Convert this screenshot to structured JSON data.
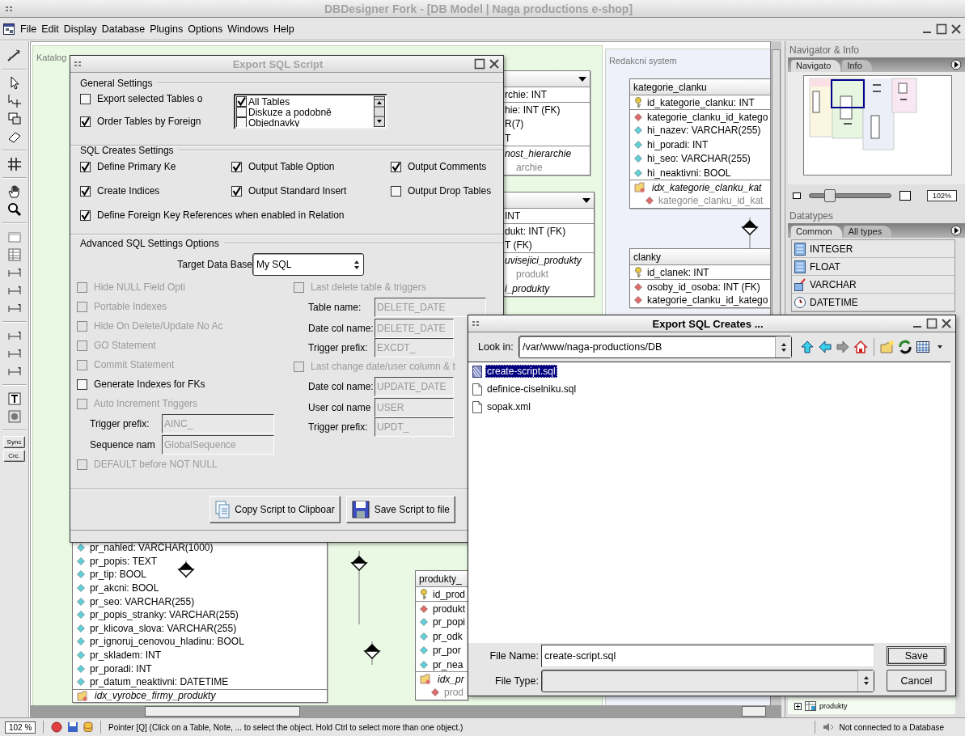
{
  "window": {
    "title": "DBDesigner Fork - [DB Model | Naga productions e-shop]"
  },
  "menu": [
    "File",
    "Edit",
    "Display",
    "Database",
    "Plugins",
    "Options",
    "Windows",
    "Help"
  ],
  "toolbox": {
    "buttons": [
      "Sync",
      "Crc."
    ]
  },
  "canvas": {
    "regions": [
      {
        "title": "Katalog",
        "color": "#eaf9e4"
      },
      {
        "title": "Redakcni system",
        "color": "#eef0fa"
      }
    ],
    "tables": [
      {
        "header": true,
        "columns": [
          {
            "kind": "plain_pk",
            "text": "rchie: INT"
          },
          {
            "kind": "plain",
            "text": "hie: INT (FK)"
          },
          {
            "kind": "plain",
            "text": "R(7)"
          },
          {
            "kind": "plain",
            "text": "T"
          },
          {
            "kind": "plain_idx",
            "text": "nost_hierarchie"
          },
          {
            "kind": "plain_idxcol",
            "text": "archie"
          }
        ]
      },
      {
        "header": true,
        "columns": [
          {
            "kind": "plain_pk",
            "text": "INT"
          },
          {
            "kind": "plain",
            "text": "dukt: INT (FK)"
          },
          {
            "kind": "plain",
            "text": "T (FK)"
          },
          {
            "kind": "plain_idx",
            "text": "uvisejici_produkty"
          },
          {
            "kind": "plain_idxcol",
            "text": "produkt"
          },
          {
            "kind": "plain_idx",
            "text": "i_produkty"
          }
        ]
      },
      {
        "header": true,
        "name": "kategorie_clanku",
        "columns": [
          {
            "kind": "pk",
            "text": "id_kategorie_clanku: INT"
          },
          {
            "kind": "fk",
            "text": "kategorie_clanku_id_katego"
          },
          {
            "kind": "col",
            "text": "hi_nazev: VARCHAR(255)"
          },
          {
            "kind": "col",
            "text": "hi_poradi: INT"
          },
          {
            "kind": "col",
            "text": "hi_seo: VARCHAR(255)"
          },
          {
            "kind": "col",
            "text": "hi_neaktivni: BOOL"
          },
          {
            "kind": "idx",
            "text": "idx_kategorie_clanku_kat"
          },
          {
            "kind": "idxcol",
            "text": "kategorie_clanku_id_kat"
          }
        ]
      },
      {
        "header": true,
        "name": "clanky",
        "columns": [
          {
            "kind": "pk",
            "text": "id_clanek: INT"
          },
          {
            "kind": "fk",
            "text": "osoby_id_osoba: INT (FK)"
          },
          {
            "kind": "fk",
            "text": "kategorie_clanku_id_katego"
          }
        ]
      },
      {
        "header": false,
        "columns": [
          {
            "kind": "col",
            "text": "pr_nahled: VARCHAR(1000)"
          },
          {
            "kind": "col",
            "text": "pr_popis: TEXT"
          },
          {
            "kind": "col",
            "text": "pr_tip: BOOL"
          },
          {
            "kind": "col",
            "text": "pr_akcni: BOOL"
          },
          {
            "kind": "col",
            "text": "pr_seo: VARCHAR(255)"
          },
          {
            "kind": "col",
            "text": "pr_popis_stranky: VARCHAR(255)"
          },
          {
            "kind": "col",
            "text": "pr_klicova_slova: VARCHAR(255)"
          },
          {
            "kind": "col",
            "text": "pr_ignoruj_cenovou_hladinu: BOOL"
          },
          {
            "kind": "col",
            "text": "pr_skladem: INT"
          },
          {
            "kind": "col",
            "text": "pr_poradi: INT"
          },
          {
            "kind": "col",
            "text": "pr_datum_neaktivni: DATETIME"
          },
          {
            "kind": "idx",
            "text": "idx_vyrobce_firmy_produkty"
          }
        ]
      },
      {
        "header": true,
        "name": "produkty_",
        "columns": [
          {
            "kind": "pk",
            "text": "id_prod"
          },
          {
            "kind": "fk",
            "text": "produkt"
          },
          {
            "kind": "col",
            "text": "pr_popi"
          },
          {
            "kind": "col",
            "text": "pr_odk"
          },
          {
            "kind": "col",
            "text": "pr_por"
          },
          {
            "kind": "col",
            "text": "pr_nea"
          },
          {
            "kind": "idx",
            "text": "idx_pr"
          },
          {
            "kind": "idxcol",
            "text": "prod"
          }
        ]
      }
    ]
  },
  "navigator": {
    "title": "Navigator & Info",
    "tabs": [
      {
        "label": "Navigato",
        "selected": true
      },
      {
        "label": "Info",
        "selected": false
      }
    ],
    "zoom": {
      "level": 0.25,
      "reading": "102%"
    }
  },
  "datatypes": {
    "title": "Datatypes",
    "tabs": [
      {
        "label": "Common",
        "selected": true
      },
      {
        "label": "All types",
        "selected": false
      }
    ],
    "items": [
      "INTEGER",
      "FLOAT",
      "VARCHAR",
      "DATETIME"
    ]
  },
  "tree": {
    "items": [
      {
        "label": "produkty",
        "expanded": false
      }
    ]
  },
  "status_bar": {
    "zoom": "102 %",
    "message": "Pointer [Q] (Click on a Table, Note, ... to select the object. Hold Ctrl to select more than one object.)",
    "connection": "Not connected to a Database"
  },
  "export_dialog": {
    "title": "Export SQL Script",
    "general": {
      "title": "General Settings",
      "options": [
        {
          "label": "Export selected Tables o",
          "checked": false
        },
        {
          "label": "Order Tables by Foreign",
          "checked": true
        }
      ],
      "table_list": [
        {
          "label": "All Tables",
          "checked": true
        },
        {
          "label": "Diskuze a podobně",
          "checked": false
        },
        {
          "label": "Objednavky",
          "checked": false
        }
      ]
    },
    "creates": {
      "title": "SQL Creates Settings",
      "options": [
        {
          "label": "Define Primary Ke",
          "checked": true
        },
        {
          "label": "Output Table Option",
          "checked": true
        },
        {
          "label": "Output Comments",
          "checked": true
        },
        {
          "label": "Create Indices",
          "checked": true
        },
        {
          "label": "Output Standard Insert",
          "checked": true
        },
        {
          "label": "Output Drop Tables",
          "checked": false
        },
        {
          "label": "Define Foreign Key References when enabled in Relation",
          "checked": true
        }
      ]
    },
    "advanced": {
      "title": "Advanced SQL Settings Options",
      "target_label": "Target Data Base",
      "target_value": "My SQL",
      "left": [
        {
          "kind": "check",
          "label": "Hide NULL Field Opti",
          "checked": false,
          "disabled": true
        },
        {
          "kind": "check",
          "label": "Portable Indexes",
          "checked": false,
          "disabled": true
        },
        {
          "kind": "check",
          "label": "Hide On Delete/Update No Ac",
          "checked": false,
          "disabled": true
        },
        {
          "kind": "check",
          "label": "GO Statement",
          "checked": false,
          "disabled": true
        },
        {
          "kind": "check",
          "label": "Commit Statement",
          "checked": false,
          "disabled": true
        },
        {
          "kind": "check",
          "label": "Generate Indexes for FKs",
          "checked": false,
          "disabled": false
        },
        {
          "kind": "check",
          "label": "Auto Increment Triggers",
          "checked": false,
          "disabled": true
        },
        {
          "kind": "field",
          "label": "Trigger prefix:",
          "value": "AINC_"
        },
        {
          "kind": "field",
          "label": "Sequence nam",
          "value": "GlobalSequence"
        },
        {
          "kind": "check",
          "label": "DEFAULT before NOT NULL",
          "checked": false,
          "disabled": true
        }
      ],
      "right": [
        {
          "kind": "check",
          "label": "Last delete table & triggers",
          "checked": false,
          "disabled": true
        },
        {
          "kind": "field",
          "label": "Table name:",
          "value": "DELETE_DATE"
        },
        {
          "kind": "field",
          "label": "Date col name:",
          "value": "DELETE_DATE"
        },
        {
          "kind": "field",
          "label": "Trigger prefix:",
          "value": "EXCDT_"
        },
        {
          "kind": "check",
          "label": "Last change date/user column & t",
          "checked": false,
          "disabled": true
        },
        {
          "kind": "field",
          "label": "Date col name:",
          "value": "UPDATE_DATE"
        },
        {
          "kind": "field",
          "label": "User col name",
          "value": "USER"
        },
        {
          "kind": "field",
          "label": "Trigger prefix:",
          "value": "UPDT_"
        }
      ]
    },
    "buttons": [
      {
        "kind": "copy",
        "label": "Copy Script to Clipboar"
      },
      {
        "kind": "save",
        "label": "Save Script to file"
      }
    ]
  },
  "file_dialog": {
    "title": "Export SQL Creates ...",
    "look_in_label": "Look in:",
    "look_in": "/var/www/naga-productions/DB",
    "files": [
      {
        "name": "create-script.sql",
        "selected": true
      },
      {
        "name": "definice-ciselniku.sql",
        "selected": false
      },
      {
        "name": "sopak.xml",
        "selected": false
      }
    ],
    "file_name_label": "File Name:",
    "file_name": "create-script.sql",
    "file_type_label": "File Type:",
    "buttons": [
      {
        "kind": "default",
        "label": "Save"
      },
      {
        "kind": "normal",
        "label": "Cancel"
      }
    ]
  }
}
